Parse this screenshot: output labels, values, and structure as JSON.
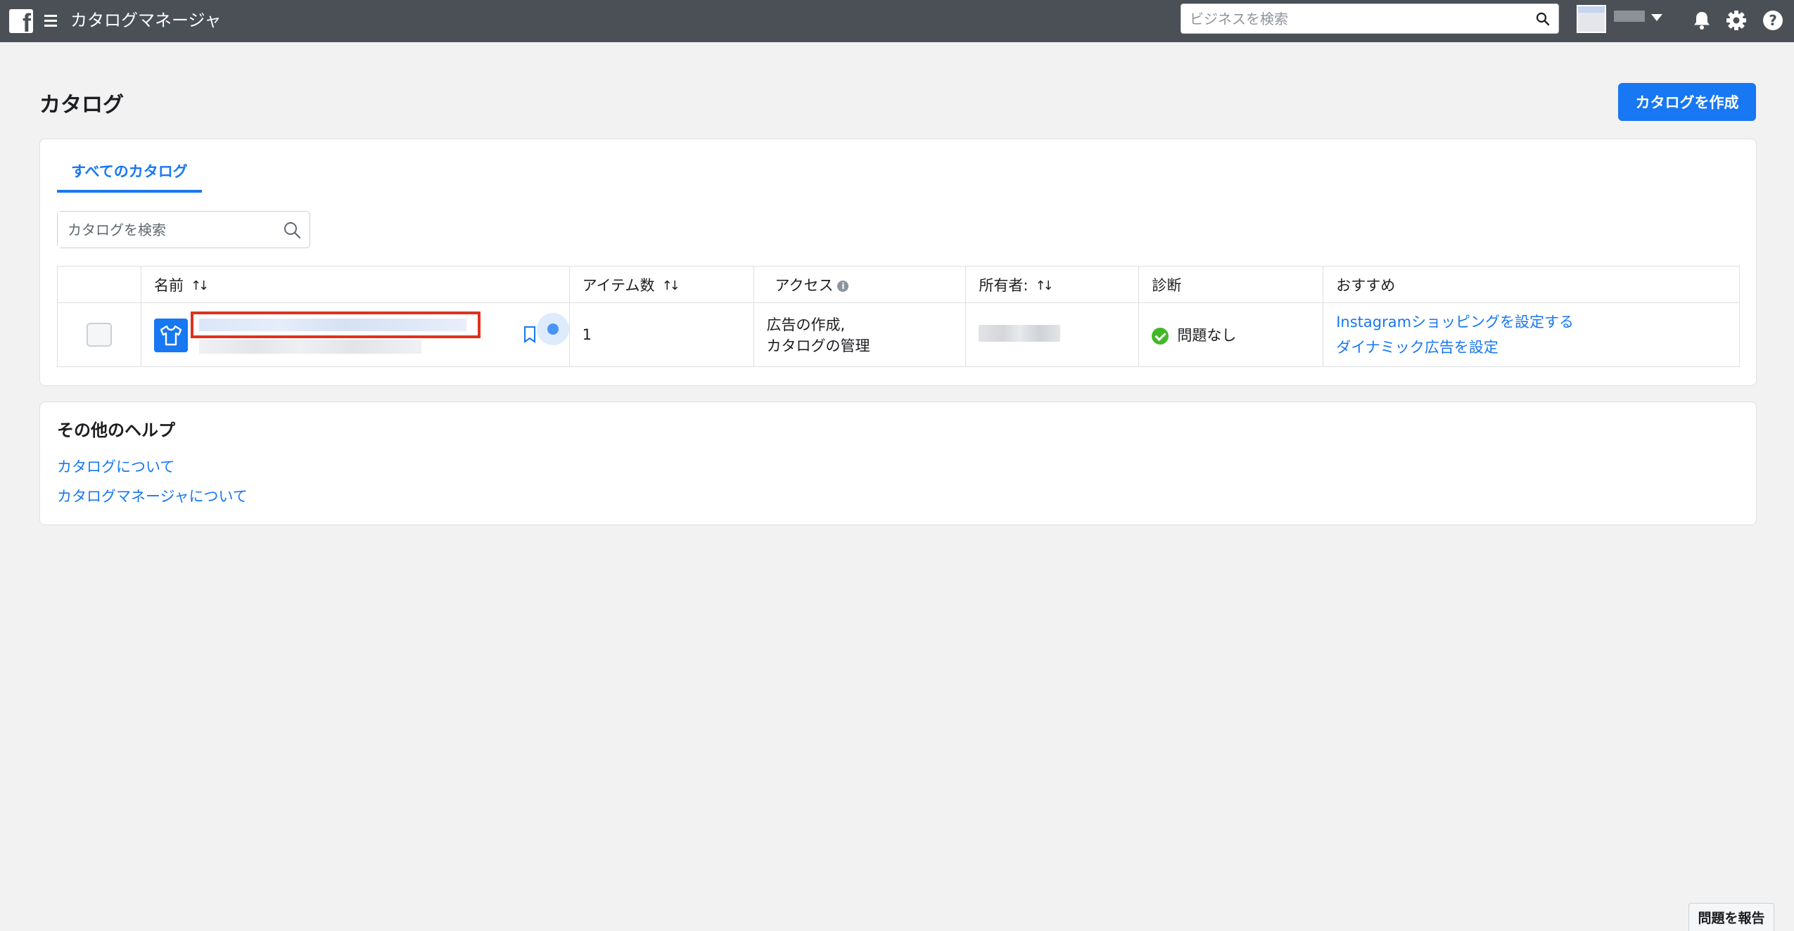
{
  "topbar": {
    "logo_letter": "f",
    "app_title": "カタログマネージャ",
    "search_placeholder": "ビジネスを検索"
  },
  "page": {
    "title": "カタログ",
    "create_button": "カタログを作成"
  },
  "catalogs_card": {
    "tab_label": "すべてのカタログ",
    "search_placeholder": "カタログを検索",
    "columns": [
      "名前",
      "アイテム数",
      "アクセス",
      "所有者:",
      "診断",
      "おすすめ"
    ],
    "rows": [
      {
        "item_count": "1",
        "access_line1": "広告の作成,",
        "access_line2": "カタログの管理",
        "diagnosis": "問題なし",
        "recommendations": [
          "Instagramショッピングを設定する",
          "ダイナミック広告を設定"
        ]
      }
    ]
  },
  "help_card": {
    "title": "その他のヘルプ",
    "links": [
      "カタログについて",
      "カタログマネージャについて"
    ]
  },
  "report_button": "問題を報告",
  "colors": {
    "topbar": "#4b4f56",
    "accent": "#1877f2",
    "success": "#42b72a",
    "highlight": "#e0321e"
  }
}
